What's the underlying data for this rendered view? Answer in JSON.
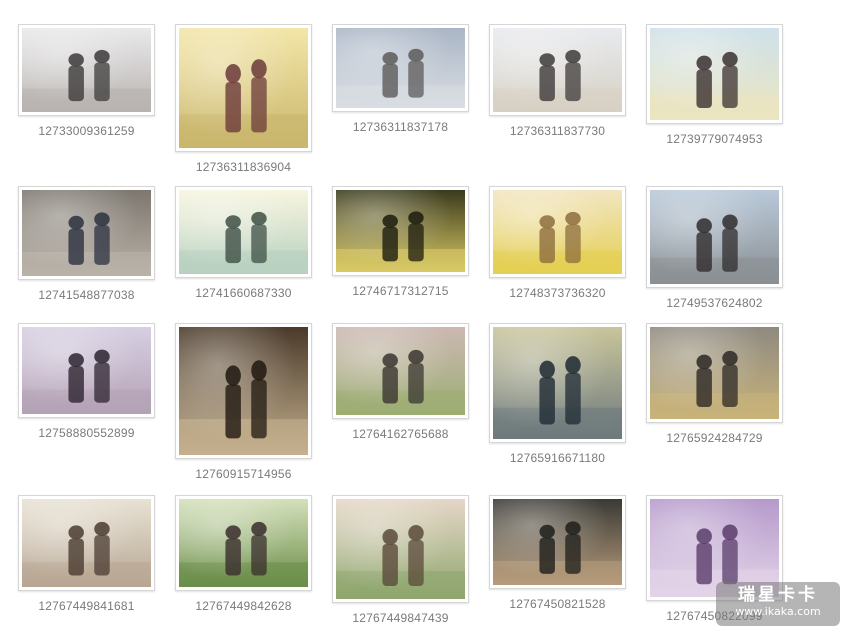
{
  "gallery": {
    "items": [
      {
        "caption": "12733009361259",
        "palette": [
          "#e9e9ea",
          "#b8b3b0",
          "#3c3a3a"
        ],
        "subject": "couple-embrace"
      },
      {
        "caption": "12736311836904",
        "palette": [
          "#f3e6a8",
          "#c9b66c",
          "#6b3a3a"
        ],
        "subject": "couple-crouching"
      },
      {
        "caption": "12736311837178",
        "palette": [
          "#aab6c6",
          "#d9dde2",
          "#5c5a5a"
        ],
        "subject": "couple-sky"
      },
      {
        "caption": "12736311837730",
        "palette": [
          "#e8eaee",
          "#d7d1c4",
          "#3d3a3a"
        ],
        "subject": "couple-beach-walk"
      },
      {
        "caption": "12739779074953",
        "palette": [
          "#cfe1ea",
          "#ebe5bf",
          "#3b3030"
        ],
        "subject": "couple-piggyback"
      },
      {
        "caption": "12741548877038",
        "palette": [
          "#7d7770",
          "#b9b2a8",
          "#2c3140"
        ],
        "subject": "couple-kiss"
      },
      {
        "caption": "12741660687330",
        "palette": [
          "#f7f5df",
          "#b7d0bf",
          "#3e4f45"
        ],
        "subject": "couple-sunlight"
      },
      {
        "caption": "12746717312715",
        "palette": [
          "#3a3a1c",
          "#d8c965",
          "#1c1b0e"
        ],
        "subject": "couple-fog"
      },
      {
        "caption": "12748373736320",
        "palette": [
          "#f2e5c0",
          "#e4cf52",
          "#8d6d3d"
        ],
        "subject": "flower-field"
      },
      {
        "caption": "12749537624802",
        "palette": [
          "#b9c9d9",
          "#8a8f93",
          "#2f2c2d"
        ],
        "subject": "couple-rocks"
      },
      {
        "caption": "12758880552899",
        "palette": [
          "#d7cfe2",
          "#b4a2b5",
          "#2d2430"
        ],
        "subject": "couple-bokeh"
      },
      {
        "caption": "12760915714956",
        "palette": [
          "#4a3a2a",
          "#c4b08e",
          "#201810"
        ],
        "subject": "couple-rain-street"
      },
      {
        "caption": "12764162765688",
        "palette": [
          "#cbb8b2",
          "#9dae73",
          "#3a3530"
        ],
        "subject": "couple-riverbank"
      },
      {
        "caption": "12765916671180",
        "palette": [
          "#c9c59b",
          "#6e7a7d",
          "#1f2a33"
        ],
        "subject": "beach-silhouette"
      },
      {
        "caption": "12765924284729",
        "palette": [
          "#8f8a80",
          "#c8b37a",
          "#2d2825"
        ],
        "subject": "couple-sunflare"
      },
      {
        "caption": "12767449841681",
        "palette": [
          "#e8e2d4",
          "#b7a693",
          "#4a3b30"
        ],
        "subject": "couple-bed"
      },
      {
        "caption": "12767449842628",
        "palette": [
          "#d4e0ba",
          "#6b8e4a",
          "#3a2d2d"
        ],
        "subject": "couple-running"
      },
      {
        "caption": "12767449847439",
        "palette": [
          "#e5d7c7",
          "#8fa66e",
          "#5a4a3a"
        ],
        "subject": "couple-swing"
      },
      {
        "caption": "12767450821528",
        "palette": [
          "#3a3a35",
          "#b59b7b",
          "#1e1e1a"
        ],
        "subject": "couple-storefront"
      },
      {
        "caption": "12767450822099",
        "palette": [
          "#b59acb",
          "#e3d4e8",
          "#5a3d6a"
        ],
        "subject": "couple-reading"
      }
    ]
  },
  "watermark": {
    "title": "瑞星卡卡",
    "url": "www.ikaka.com"
  }
}
